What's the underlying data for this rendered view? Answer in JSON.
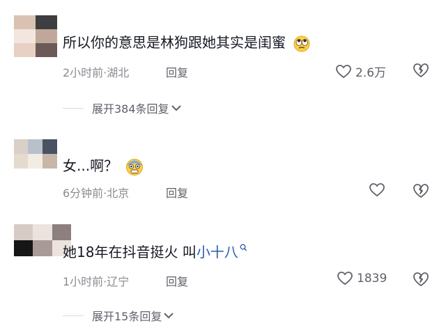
{
  "comments": [
    {
      "text": "所以你的意思是林狗跟她其实是闺蜜",
      "emoji": "rolling-eyes-emoji",
      "time": "2小时前·湖北",
      "reply_label": "回复",
      "likes": "2.6万",
      "expand_label": "展开384条回复",
      "avatar_colors": [
        "#d9c2b2",
        "#3e3e40",
        "#f2e6de",
        "#bfa89a",
        "#e8d0c4",
        "#6b5a58"
      ]
    },
    {
      "text": "女...啊？",
      "emoji": "fearful-face-emoji",
      "time": "6分钟前·北京",
      "reply_label": "回复",
      "likes": "",
      "avatar_colors": [
        "#d9d0c9",
        "#b8c0cb",
        "#4a5262",
        "#e6d9cd",
        "#f3ece5",
        "#c8b7a8"
      ]
    },
    {
      "text_prefix": "她18年在抖音挺火 叫",
      "text_link": "小十八",
      "time": "1小时前·辽宁",
      "reply_label": "回复",
      "likes": "1839",
      "expand_label": "展开15条回复",
      "avatar_colors": [
        "#d7cbc6",
        "#161616",
        "#ede3de",
        "#8c7f7d",
        "#262626",
        "#a89a96"
      ]
    }
  ],
  "icon_colors": {
    "heart": "#5f6069",
    "link": "#2c5aa8"
  }
}
